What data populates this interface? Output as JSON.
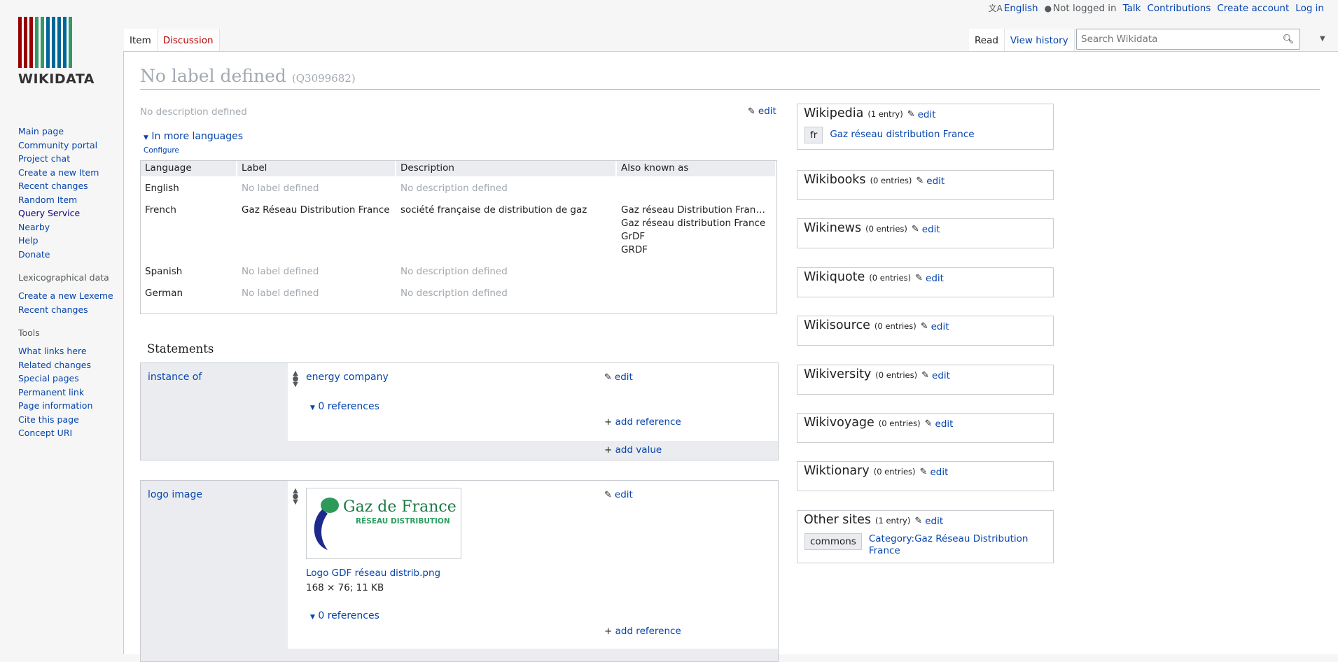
{
  "header": {
    "language": "English",
    "not_logged_in": "Not logged in",
    "links": [
      "Talk",
      "Contributions",
      "Create account",
      "Log in"
    ],
    "tabs_left": [
      "Item",
      "Discussion"
    ],
    "tabs_right": [
      "Read",
      "View history"
    ],
    "search_placeholder": "Search Wikidata"
  },
  "logo": {
    "text": "WIKIDATA",
    "bar_colors": [
      "#990000",
      "#990000",
      "#990000",
      "#339966",
      "#339966",
      "#006699",
      "#006699",
      "#006699",
      "#006699",
      "#339966"
    ]
  },
  "sidebar": {
    "main_links": [
      "Main page",
      "Community portal",
      "Project chat",
      "Create a new Item",
      "Recent changes",
      "Random Item",
      "Query Service",
      "Nearby",
      "Help",
      "Donate"
    ],
    "lexeme_heading": "Lexicographical data",
    "lexeme_links": [
      "Create a new Lexeme",
      "Recent changes"
    ],
    "tools_heading": "Tools",
    "tools_links": [
      "What links here",
      "Related changes",
      "Special pages",
      "Permanent link",
      "Page information",
      "Cite this page",
      "Concept URI"
    ]
  },
  "page": {
    "title": "No label defined",
    "qid": "(Q3099682)",
    "description": "No description defined",
    "edit": "edit",
    "in_more_languages": "In more languages",
    "configure": "Configure"
  },
  "lang_table": {
    "headers": [
      "Language",
      "Label",
      "Description",
      "Also known as"
    ],
    "rows": [
      {
        "language": "English",
        "label": "No label defined",
        "description": "No description defined",
        "aliases": []
      },
      {
        "language": "French",
        "label": "Gaz Réseau Distribution France",
        "description": "société française de distribution de gaz",
        "aliases": [
          "Gaz réseau Distribution Fran…",
          "Gaz réseau distribution France",
          "GrDF",
          "GRDF"
        ]
      },
      {
        "language": "Spanish",
        "label": "No label defined",
        "description": "No description defined",
        "aliases": []
      },
      {
        "language": "German",
        "label": "No label defined",
        "description": "No description defined",
        "aliases": []
      }
    ]
  },
  "statements": {
    "heading": "Statements",
    "items": [
      {
        "property": "instance of",
        "value": "energy company",
        "references": "0 references",
        "add_reference": "add reference",
        "add_value": "add value",
        "edit": "edit"
      },
      {
        "property": "logo image",
        "file": "Logo GDF réseau distrib.png",
        "file_meta": "168 × 76; 11 KB",
        "references": "0 references",
        "add_reference": "add reference",
        "edit": "edit",
        "logo_text_1": "Gaz de France",
        "logo_text_2": "RÉSEAU DISTRIBUTION"
      }
    ]
  },
  "sitelinks": [
    {
      "name": "Wikipedia",
      "count": "(1 entry)",
      "edit": "edit",
      "links": [
        {
          "code": "fr",
          "title": "Gaz réseau distribution France"
        }
      ]
    },
    {
      "name": "Wikibooks",
      "count": "(0 entries)",
      "edit": "edit",
      "links": []
    },
    {
      "name": "Wikinews",
      "count": "(0 entries)",
      "edit": "edit",
      "links": []
    },
    {
      "name": "Wikiquote",
      "count": "(0 entries)",
      "edit": "edit",
      "links": []
    },
    {
      "name": "Wikisource",
      "count": "(0 entries)",
      "edit": "edit",
      "links": []
    },
    {
      "name": "Wikiversity",
      "count": "(0 entries)",
      "edit": "edit",
      "links": []
    },
    {
      "name": "Wikivoyage",
      "count": "(0 entries)",
      "edit": "edit",
      "links": []
    },
    {
      "name": "Wiktionary",
      "count": "(0 entries)",
      "edit": "edit",
      "links": []
    },
    {
      "name": "Other sites",
      "count": "(1 entry)",
      "edit": "edit",
      "links": [
        {
          "code": "commons",
          "title": "Category:Gaz Réseau Distribution France"
        }
      ]
    }
  ]
}
